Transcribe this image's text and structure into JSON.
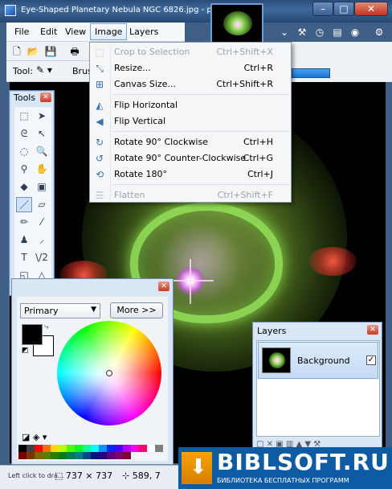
{
  "window": {
    "title": "Eye-Shaped Planetary Nebula NGC 6826.jpg - paint.ne...",
    "min": "–",
    "max": "□",
    "close": "✕"
  },
  "menubar": {
    "file": "File",
    "edit": "Edit",
    "view": "View",
    "image": "Image",
    "layers": "Layers"
  },
  "toolbar": {
    "tool_label": "Tool:",
    "brush_label": "Brus"
  },
  "image_menu": [
    {
      "icon": "crop-icon",
      "glyph": "⬚",
      "label": "Crop to Selection",
      "shortcut": "Ctrl+Shift+X",
      "enabled": false
    },
    {
      "icon": "resize-icon",
      "glyph": "⤡",
      "label": "Resize...",
      "shortcut": "Ctrl+R",
      "enabled": true
    },
    {
      "icon": "canvas-size-icon",
      "glyph": "⊞",
      "label": "Canvas Size...",
      "shortcut": "Ctrl+Shift+R",
      "enabled": true
    },
    {
      "icon": "flip-horizontal-icon",
      "glyph": "◭",
      "label": "Flip Horizontal",
      "shortcut": "",
      "enabled": true
    },
    {
      "icon": "flip-vertical-icon",
      "glyph": "◀",
      "label": "Flip Vertical",
      "shortcut": "",
      "enabled": true
    },
    {
      "icon": "rotate-cw-icon",
      "glyph": "↻",
      "label": "Rotate 90° Clockwise",
      "shortcut": "Ctrl+H",
      "enabled": true
    },
    {
      "icon": "rotate-ccw-icon",
      "glyph": "↺",
      "label": "Rotate 90° Counter-Clockwise",
      "shortcut": "Ctrl+G",
      "enabled": true
    },
    {
      "icon": "rotate-180-icon",
      "glyph": "⟲",
      "label": "Rotate 180°",
      "shortcut": "Ctrl+J",
      "enabled": true
    },
    {
      "icon": "flatten-icon",
      "glyph": "☰",
      "label": "Flatten",
      "shortcut": "Ctrl+Shift+F",
      "enabled": false
    }
  ],
  "tools_panel": {
    "title": "Tools",
    "close": "✕"
  },
  "colors_panel": {
    "close": "✕",
    "mode": "Primary",
    "more_button": "More >>",
    "primary_color": "#000000",
    "secondary_color": "#ffffff",
    "palette": [
      "#000000",
      "#404040",
      "#ff0000",
      "#ff6a00",
      "#ffd800",
      "#b6ff00",
      "#4cff00",
      "#00ff21",
      "#00ff90",
      "#00ffff",
      "#0094ff",
      "#0026ff",
      "#4800ff",
      "#b200ff",
      "#ff00dc",
      "#ff006e",
      "#ffffff",
      "#808080",
      "#7f0000",
      "#7f3300",
      "#7f6a00",
      "#5b7f00",
      "#267f00",
      "#007f0e",
      "#007f46",
      "#007f7f",
      "#004a7f",
      "#00137f",
      "#21007f",
      "#57007f",
      "#7f006e",
      "#7f0037"
    ]
  },
  "layers_panel": {
    "title": "Layers",
    "close": "✕",
    "layer_name": "Background",
    "layer_visible": "✓"
  },
  "statusbar": {
    "hint": "Left click to dra...",
    "size": "737 × 737",
    "position": "589, 7"
  },
  "watermark": {
    "title": "BIBLSOFT.RU",
    "subtitle": "БИБЛИОТЕКА БЕСПЛАТНЫХ ПРОГРАММ"
  }
}
